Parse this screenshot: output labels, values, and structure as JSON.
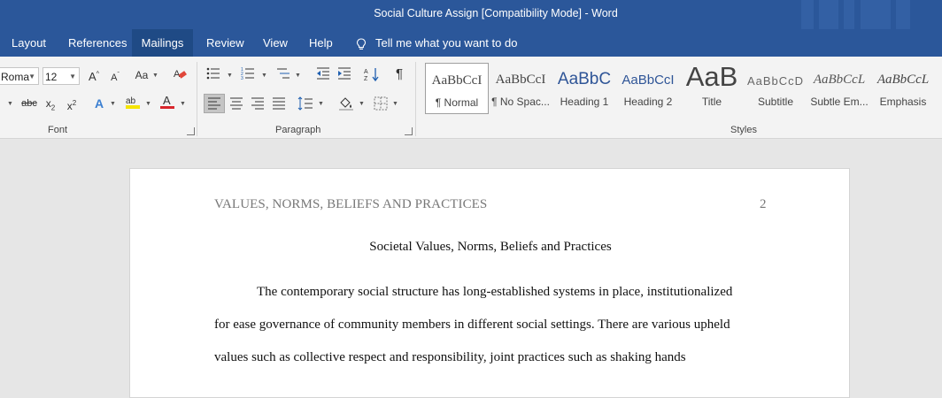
{
  "window": {
    "title": "Social Culture Assign [Compatibility Mode]  -  Word"
  },
  "menu": {
    "tabs": [
      {
        "label": "Layout"
      },
      {
        "label": "References"
      },
      {
        "label": "Mailings"
      },
      {
        "label": "Review"
      },
      {
        "label": "View"
      },
      {
        "label": "Help"
      }
    ],
    "tell_me": "Tell me what you want to do"
  },
  "ribbon": {
    "font": {
      "label": "Font",
      "font_name": "Roma",
      "font_size": "12",
      "change_case": "Aa"
    },
    "paragraph": {
      "label": "Paragraph"
    },
    "styles": {
      "label": "Styles",
      "items": [
        {
          "preview": "AaBbCcI",
          "name": "¶ Normal"
        },
        {
          "preview": "AaBbCcI",
          "name": "¶ No Spac..."
        },
        {
          "preview": "AaBbC",
          "name": "Heading 1"
        },
        {
          "preview": "AaBbCcI",
          "name": "Heading 2"
        },
        {
          "preview": "AaB",
          "name": "Title"
        },
        {
          "preview": "AaBbCcD",
          "name": "Subtitle"
        },
        {
          "preview": "AaBbCcL",
          "name": "Subtle Em..."
        },
        {
          "preview": "AaBbCcL",
          "name": "Emphasis"
        }
      ]
    }
  },
  "document": {
    "running_header": "VALUES, NORMS, BELIEFS AND PRACTICES",
    "page_number": "2",
    "title": "Societal Values, Norms, Beliefs and Practices",
    "lines": [
      "The contemporary social structure has long-established systems in place, institutionalized",
      "for ease governance of community members in different social settings. There are various upheld",
      "values such as collective respect and responsibility, joint practices such as shaking hands"
    ]
  },
  "colors": {
    "word_blue": "#2b579a",
    "ribbon_bg": "#f3f3f3",
    "canvas_bg": "#e6e6e6"
  }
}
